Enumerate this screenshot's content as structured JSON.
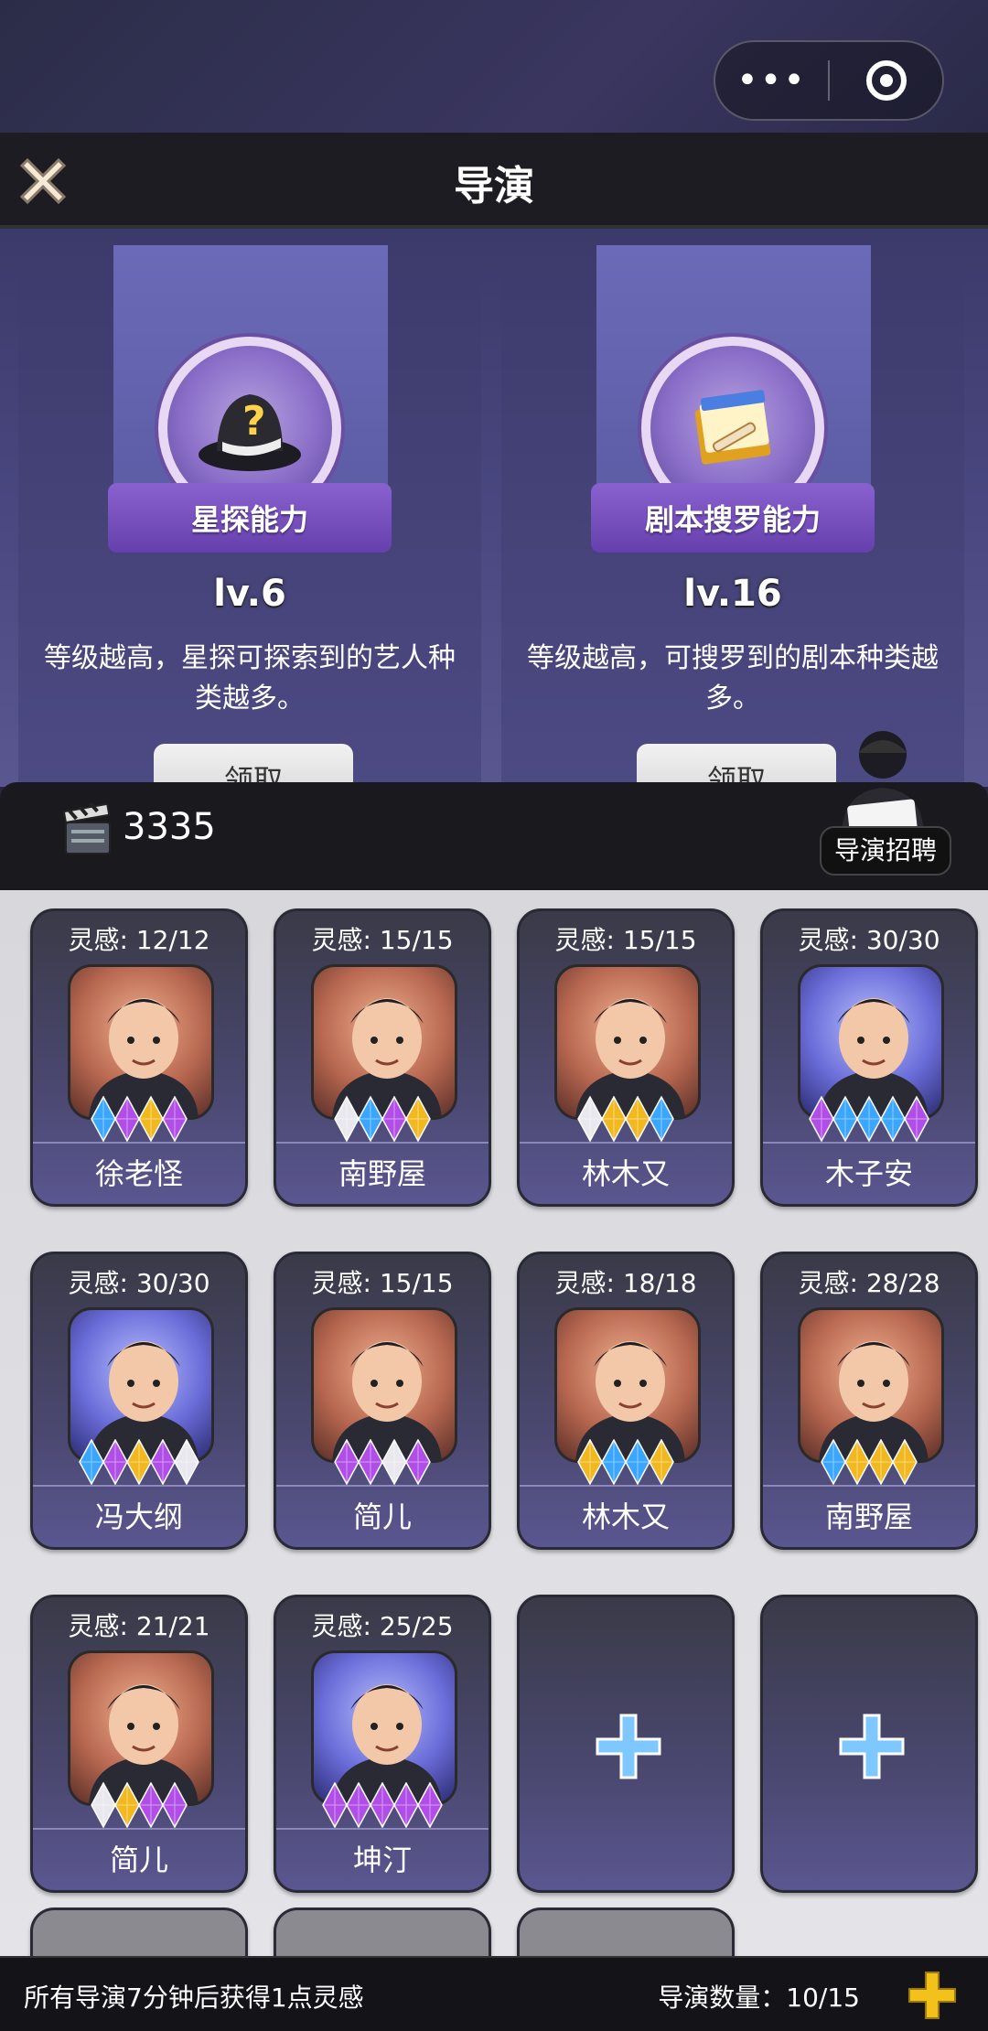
{
  "header": {
    "menu_dots": "•••",
    "title": "导演"
  },
  "abilities": [
    {
      "name": "星探能力",
      "level": "lv.6",
      "desc": "等级越高，星探可探索到的艺人种类越多。",
      "button": "领取",
      "icon": "detective-hat-icon"
    },
    {
      "name": "剧本搜罗能力",
      "level": "lv.16",
      "desc": "等级越高，可搜罗到的剧本种类越多。",
      "button": "领取",
      "icon": "script-book-icon"
    }
  ],
  "resources": {
    "film_count": "3335",
    "recruit_label": "导演招聘"
  },
  "directors": [
    {
      "inspiration": "灵感: 12/12",
      "name": "徐老怪",
      "gems": [
        "blue",
        "purple",
        "gold",
        "purple"
      ]
    },
    {
      "inspiration": "灵感: 15/15",
      "name": "南野屋",
      "gems": [
        "white",
        "blue",
        "purple",
        "gold"
      ]
    },
    {
      "inspiration": "灵感: 15/15",
      "name": "林木又",
      "gems": [
        "white",
        "gold",
        "gold",
        "blue"
      ]
    },
    {
      "inspiration": "灵感: 30/30",
      "name": "木子安",
      "gems": [
        "purple",
        "blue",
        "blue",
        "blue",
        "purple"
      ]
    },
    {
      "inspiration": "灵感: 30/30",
      "name": "冯大纲",
      "gems": [
        "blue",
        "purple",
        "gold",
        "purple",
        "white"
      ]
    },
    {
      "inspiration": "灵感: 15/15",
      "name": "简儿",
      "gems": [
        "purple",
        "purple",
        "white",
        "purple"
      ]
    },
    {
      "inspiration": "灵感: 18/18",
      "name": "林木又",
      "gems": [
        "gold",
        "blue",
        "blue",
        "gold"
      ]
    },
    {
      "inspiration": "灵感: 28/28",
      "name": "南野屋",
      "gems": [
        "blue",
        "gold",
        "gold",
        "gold"
      ]
    },
    {
      "inspiration": "灵感: 21/21",
      "name": "简儿",
      "gems": [
        "white",
        "gold",
        "purple",
        "purple"
      ]
    },
    {
      "inspiration": "灵感: 25/25",
      "name": "坤汀",
      "gems": [
        "purple",
        "purple",
        "purple",
        "purple",
        "purple"
      ]
    }
  ],
  "footer": {
    "hint": "所有导演7分钟后获得1点灵感",
    "count": "导演数量：10/15"
  },
  "colors": {
    "gem_blue": "#3aa6ff",
    "gem_purple": "#b24ee8",
    "gem_gold": "#f2b820",
    "gem_white": "#e8e8ee",
    "accent_plus": "#7ec8ff",
    "footer_plus": "#f2c21a"
  }
}
